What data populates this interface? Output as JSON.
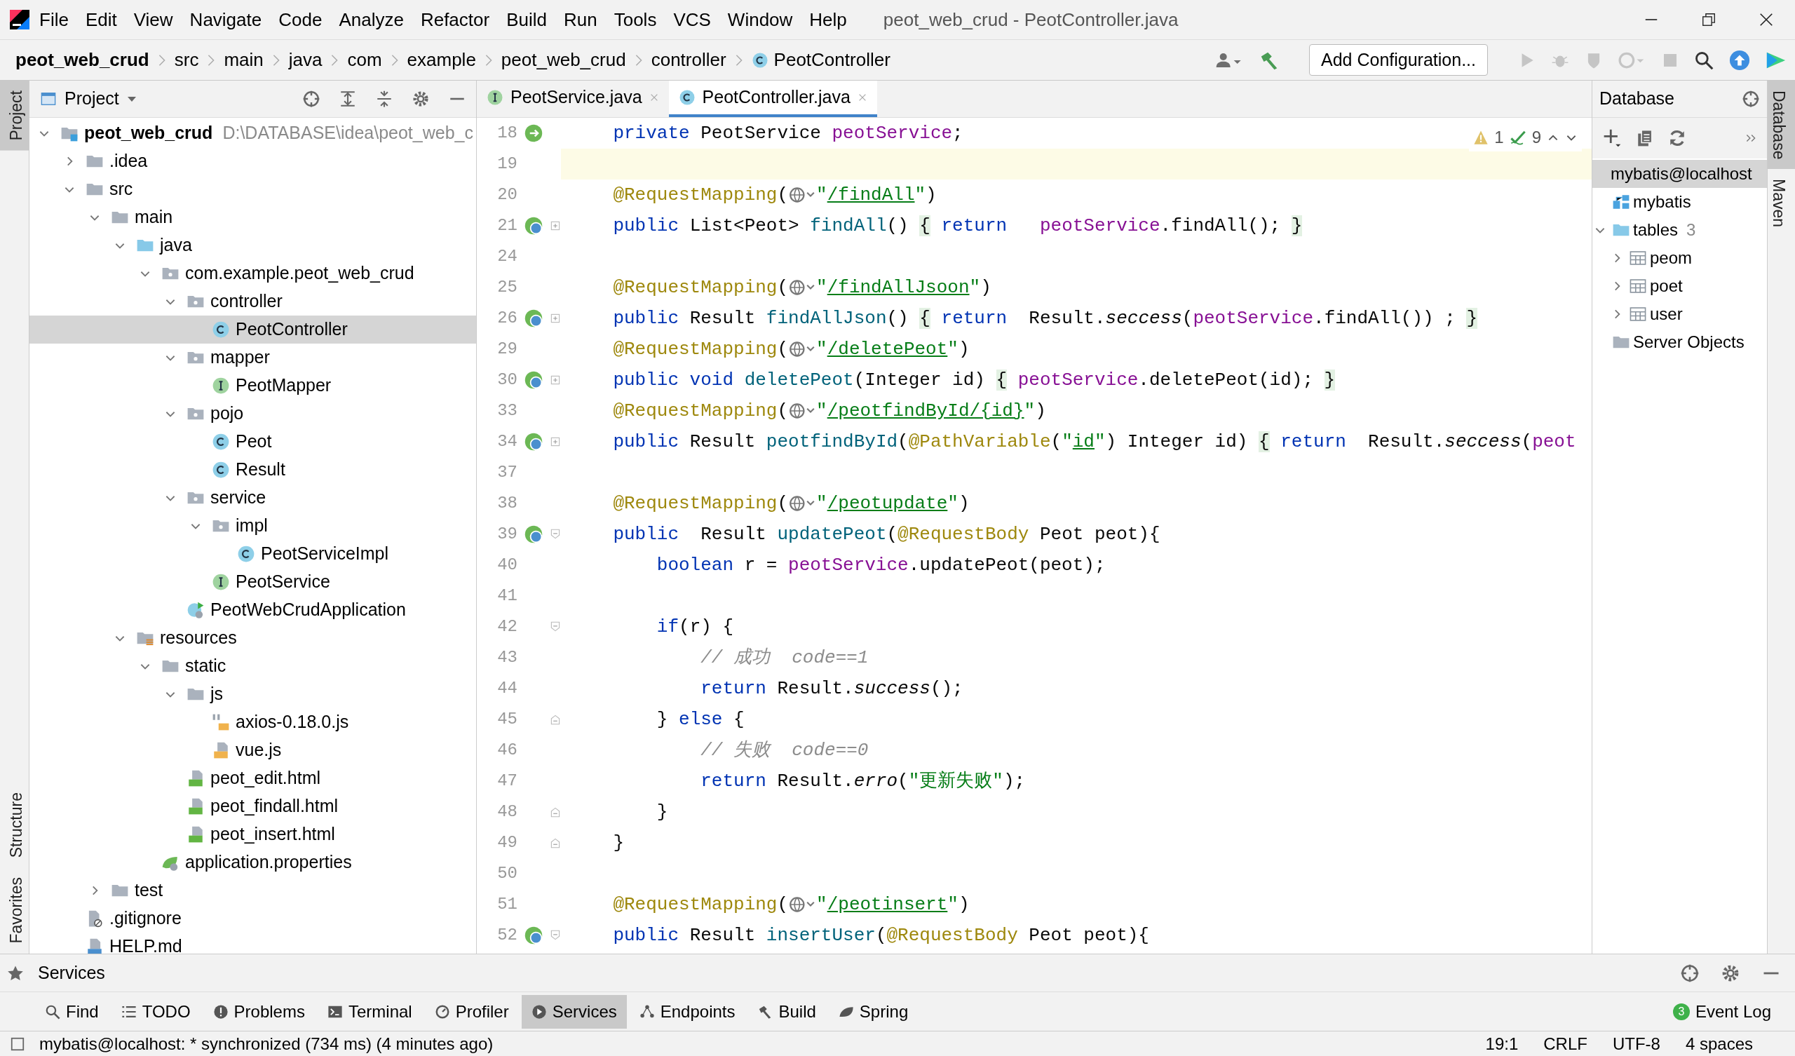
{
  "menu_bar": {
    "items": [
      "File",
      "Edit",
      "View",
      "Navigate",
      "Code",
      "Analyze",
      "Refactor",
      "Build",
      "Run",
      "Tools",
      "VCS",
      "Window",
      "Help"
    ],
    "window_title": "peot_web_crud - PeotController.java"
  },
  "breadcrumbs": [
    "peot_web_crud",
    "src",
    "main",
    "java",
    "com",
    "example",
    "peot_web_crud",
    "controller",
    "PeotController"
  ],
  "run_configuration": "Add Configuration...",
  "left_tool_stripe": [
    {
      "label": "Project",
      "selected": true
    },
    {
      "label": "Structure",
      "selected": false
    },
    {
      "label": "Favorites",
      "selected": false
    }
  ],
  "project": {
    "title": "Project",
    "tree": [
      {
        "label": "peot_web_crud",
        "kind": "module",
        "note": "D:\\DATABASE\\idea\\peot_web_c",
        "expanded": true,
        "selected": false,
        "children": [
          {
            "label": ".idea",
            "kind": "folder",
            "expanded": false,
            "selected": false
          },
          {
            "label": "src",
            "kind": "folder",
            "expanded": true,
            "selected": false,
            "children": [
              {
                "label": "main",
                "kind": "folder",
                "expanded": true,
                "selected": false,
                "children": [
                  {
                    "label": "java",
                    "kind": "java-folder",
                    "expanded": true,
                    "selected": false,
                    "children": [
                      {
                        "label": "com.example.peot_web_crud",
                        "kind": "package",
                        "expanded": true,
                        "selected": false,
                        "children": [
                          {
                            "label": "controller",
                            "kind": "package",
                            "expanded": true,
                            "selected": false,
                            "children": [
                              {
                                "label": "PeotController",
                                "kind": "class",
                                "selected": true
                              }
                            ]
                          },
                          {
                            "label": "mapper",
                            "kind": "package",
                            "expanded": true,
                            "selected": false,
                            "children": [
                              {
                                "label": "PeotMapper",
                                "kind": "interface",
                                "selected": false
                              }
                            ]
                          },
                          {
                            "label": "pojo",
                            "kind": "package",
                            "expanded": true,
                            "selected": false,
                            "children": [
                              {
                                "label": "Peot",
                                "kind": "class",
                                "selected": false
                              },
                              {
                                "label": "Result",
                                "kind": "class",
                                "selected": false
                              }
                            ]
                          },
                          {
                            "label": "service",
                            "kind": "package",
                            "expanded": true,
                            "selected": false,
                            "children": [
                              {
                                "label": "impl",
                                "kind": "package",
                                "expanded": true,
                                "selected": false,
                                "children": [
                                  {
                                    "label": "PeotServiceImpl",
                                    "kind": "class",
                                    "selected": false
                                  }
                                ]
                              },
                              {
                                "label": "PeotService",
                                "kind": "interface",
                                "selected": false
                              }
                            ]
                          },
                          {
                            "label": "PeotWebCrudApplication",
                            "kind": "spring-app",
                            "selected": false
                          }
                        ]
                      }
                    ]
                  },
                  {
                    "label": "resources",
                    "kind": "resources",
                    "expanded": true,
                    "selected": false,
                    "children": [
                      {
                        "label": "static",
                        "kind": "folder",
                        "expanded": true,
                        "selected": false,
                        "children": [
                          {
                            "label": "js",
                            "kind": "folder",
                            "expanded": true,
                            "selected": false,
                            "children": [
                              {
                                "label": "axios-0.18.0.js",
                                "kind": "js-lib",
                                "selected": false
                              },
                              {
                                "label": "vue.js",
                                "kind": "js",
                                "selected": false
                              }
                            ]
                          },
                          {
                            "label": "peot_edit.html",
                            "kind": "html",
                            "selected": false
                          },
                          {
                            "label": "peot_findall.html",
                            "kind": "html",
                            "selected": false
                          },
                          {
                            "label": "peot_insert.html",
                            "kind": "html",
                            "selected": false
                          }
                        ]
                      },
                      {
                        "label": "application.properties",
                        "kind": "properties",
                        "selected": false
                      }
                    ]
                  }
                ]
              },
              {
                "label": "test",
                "kind": "folder",
                "expanded": false,
                "selected": false
              }
            ]
          },
          {
            "label": ".gitignore",
            "kind": "gitignore",
            "selected": false
          },
          {
            "label": "HELP.md",
            "kind": "md",
            "selected": false
          }
        ]
      }
    ]
  },
  "editor": {
    "tabs": [
      {
        "label": "PeotService.java",
        "kind": "interface",
        "selected": false
      },
      {
        "label": "PeotController.java",
        "kind": "class",
        "selected": true
      }
    ],
    "inspections": {
      "warnings": "1",
      "weak_warnings": "9"
    },
    "lines": [
      {
        "number": "18",
        "gutter_icon": {
          "kind": "bean"
        },
        "current": false,
        "tokens": [
          {
            "kind": "kw",
            "t": "private"
          },
          {
            "kind": "p",
            "t": " PeotService "
          },
          {
            "kind": "f",
            "t": "peotService"
          },
          {
            "kind": "p",
            "t": ";"
          }
        ]
      },
      {
        "number": "19",
        "current": true
      },
      {
        "number": "20",
        "current": false,
        "tokens": [
          {
            "kind": "an",
            "t": "@RequestMapping"
          },
          {
            "kind": "p",
            "t": "("
          },
          {
            "kind": "route"
          },
          {
            "kind": "s",
            "t": "\""
          },
          {
            "kind": "su",
            "t": "/findAll"
          },
          {
            "kind": "s",
            "t": "\""
          },
          {
            "kind": "p",
            "t": ")"
          }
        ]
      },
      {
        "number": "21",
        "gutter_icon": {
          "kind": "web"
        },
        "fold": {
          "kind": "collapsed"
        },
        "current": false,
        "tokens": [
          {
            "kind": "kw",
            "t": "public"
          },
          {
            "kind": "p",
            "t": " List<Peot> "
          },
          {
            "kind": "m",
            "t": "findAll"
          },
          {
            "kind": "p",
            "t": "() "
          },
          {
            "kind": "b",
            "t": "{"
          },
          {
            "kind": "kw",
            "t": " return   "
          },
          {
            "kind": "f",
            "t": "peotService"
          },
          {
            "kind": "p",
            "t": ".findAll(); "
          },
          {
            "kind": "b",
            "t": "}"
          }
        ]
      },
      {
        "number": "24",
        "current": false
      },
      {
        "number": "25",
        "current": false,
        "tokens": [
          {
            "kind": "an",
            "t": "@RequestMapping"
          },
          {
            "kind": "p",
            "t": "("
          },
          {
            "kind": "route"
          },
          {
            "kind": "s",
            "t": "\""
          },
          {
            "kind": "su",
            "t": "/findAllJsoon"
          },
          {
            "kind": "s",
            "t": "\""
          },
          {
            "kind": "p",
            "t": ")"
          }
        ]
      },
      {
        "number": "26",
        "gutter_icon": {
          "kind": "web"
        },
        "fold": {
          "kind": "collapsed"
        },
        "current": false,
        "tokens": [
          {
            "kind": "kw",
            "t": "public"
          },
          {
            "kind": "p",
            "t": " Result "
          },
          {
            "kind": "m",
            "t": "findAllJson"
          },
          {
            "kind": "p",
            "t": "() "
          },
          {
            "kind": "b",
            "t": "{"
          },
          {
            "kind": "kw",
            "t": " return"
          },
          {
            "kind": "p",
            "t": "  Result."
          },
          {
            "kind": "i",
            "t": "seccess"
          },
          {
            "kind": "p",
            "t": "("
          },
          {
            "kind": "f",
            "t": "peotService"
          },
          {
            "kind": "p",
            "t": ".findAll()) ; "
          },
          {
            "kind": "b",
            "t": "}"
          }
        ]
      },
      {
        "number": "29",
        "current": false,
        "tokens": [
          {
            "kind": "an",
            "t": "@RequestMapping"
          },
          {
            "kind": "p",
            "t": "("
          },
          {
            "kind": "route"
          },
          {
            "kind": "s",
            "t": "\""
          },
          {
            "kind": "su",
            "t": "/deletePeot"
          },
          {
            "kind": "s",
            "t": "\""
          },
          {
            "kind": "p",
            "t": ")"
          }
        ]
      },
      {
        "number": "30",
        "gutter_icon": {
          "kind": "web"
        },
        "fold": {
          "kind": "collapsed"
        },
        "current": false,
        "tokens": [
          {
            "kind": "kw",
            "t": "public void "
          },
          {
            "kind": "m",
            "t": "deletePeot"
          },
          {
            "kind": "p",
            "t": "(Integer id) "
          },
          {
            "kind": "b",
            "t": "{"
          },
          {
            "kind": "f",
            "t": " peotService"
          },
          {
            "kind": "p",
            "t": ".deletePeot(id); "
          },
          {
            "kind": "b",
            "t": "}"
          }
        ]
      },
      {
        "number": "33",
        "current": false,
        "tokens": [
          {
            "kind": "an",
            "t": "@RequestMapping"
          },
          {
            "kind": "p",
            "t": "("
          },
          {
            "kind": "route"
          },
          {
            "kind": "s",
            "t": "\""
          },
          {
            "kind": "su",
            "t": "/peotfindById/{id}"
          },
          {
            "kind": "s",
            "t": "\""
          },
          {
            "kind": "p",
            "t": ")"
          }
        ]
      },
      {
        "number": "34",
        "gutter_icon": {
          "kind": "web"
        },
        "fold": {
          "kind": "collapsed"
        },
        "current": false,
        "tokens": [
          {
            "kind": "kw",
            "t": "public"
          },
          {
            "kind": "p",
            "t": " Result "
          },
          {
            "kind": "m",
            "t": "peotfindById"
          },
          {
            "kind": "p",
            "t": "("
          },
          {
            "kind": "an",
            "t": "@PathVariable"
          },
          {
            "kind": "p",
            "t": "("
          },
          {
            "kind": "s",
            "t": "\""
          },
          {
            "kind": "su",
            "t": "id"
          },
          {
            "kind": "s",
            "t": "\""
          },
          {
            "kind": "p",
            "t": ") Integer id) "
          },
          {
            "kind": "b",
            "t": "{"
          },
          {
            "kind": "kw",
            "t": " return"
          },
          {
            "kind": "p",
            "t": "  Result."
          },
          {
            "kind": "i",
            "t": "seccess"
          },
          {
            "kind": "p",
            "t": "("
          },
          {
            "kind": "f",
            "t": "peot"
          }
        ]
      },
      {
        "number": "37",
        "current": false
      },
      {
        "number": "38",
        "current": false,
        "tokens": [
          {
            "kind": "an",
            "t": "@RequestMapping"
          },
          {
            "kind": "p",
            "t": "("
          },
          {
            "kind": "route"
          },
          {
            "kind": "s",
            "t": "\""
          },
          {
            "kind": "su",
            "t": "/peotupdate"
          },
          {
            "kind": "s",
            "t": "\""
          },
          {
            "kind": "p",
            "t": ")"
          }
        ]
      },
      {
        "number": "39",
        "gutter_icon": {
          "kind": "web"
        },
        "fold": {
          "kind": "open"
        },
        "current": false,
        "tokens": [
          {
            "kind": "kw",
            "t": "public"
          },
          {
            "kind": "p",
            "t": "  Result "
          },
          {
            "kind": "m",
            "t": "updatePeot"
          },
          {
            "kind": "p",
            "t": "("
          },
          {
            "kind": "an",
            "t": "@RequestBody"
          },
          {
            "kind": "p",
            "t": " Peot peot){"
          }
        ],
        "children": [
          {
            "number": "40",
            "current": false,
            "tokens": [
              {
                "kind": "kw",
                "t": "boolean"
              },
              {
                "kind": "p",
                "t": " r = "
              },
              {
                "kind": "f",
                "t": "peotService"
              },
              {
                "kind": "p",
                "t": ".updatePeot(peot);"
              }
            ]
          },
          {
            "number": "41",
            "current": false
          },
          {
            "number": "42",
            "fold": {
              "kind": "open"
            },
            "current": false,
            "tokens": [
              {
                "kind": "kw",
                "t": "if"
              },
              {
                "kind": "p",
                "t": "(r) {"
              }
            ],
            "children": [
              {
                "number": "43",
                "current": false,
                "tokens": [
                  {
                    "kind": "c",
                    "t": "// 成功  code==1"
                  }
                ]
              },
              {
                "number": "44",
                "current": false,
                "tokens": [
                  {
                    "kind": "kw",
                    "t": "return"
                  },
                  {
                    "kind": "p",
                    "t": " Result."
                  },
                  {
                    "kind": "i",
                    "t": "success"
                  },
                  {
                    "kind": "p",
                    "t": "();"
                  }
                ]
              }
            ]
          },
          {
            "number": "45",
            "fold": {
              "kind": "close"
            },
            "current": false,
            "tokens": [
              {
                "kind": "p",
                "t": "} "
              },
              {
                "kind": "kw",
                "t": "else"
              },
              {
                "kind": "p",
                "t": " {"
              }
            ],
            "children": [
              {
                "number": "46",
                "current": false,
                "tokens": [
                  {
                    "kind": "c",
                    "t": "// 失败  code==0"
                  }
                ]
              },
              {
                "number": "47",
                "current": false,
                "tokens": [
                  {
                    "kind": "kw",
                    "t": "return"
                  },
                  {
                    "kind": "p",
                    "t": " Result."
                  },
                  {
                    "kind": "i",
                    "t": "erro"
                  },
                  {
                    "kind": "p",
                    "t": "("
                  },
                  {
                    "kind": "s",
                    "t": "\"更新失败\""
                  },
                  {
                    "kind": "p",
                    "t": ");"
                  }
                ]
              }
            ]
          },
          {
            "number": "48",
            "fold": {
              "kind": "close"
            },
            "current": false,
            "tokens": [
              {
                "kind": "p",
                "t": "}"
              }
            ]
          }
        ]
      },
      {
        "number": "49",
        "fold": {
          "kind": "close"
        },
        "current": false,
        "tokens": [
          {
            "kind": "p",
            "t": "}"
          }
        ]
      },
      {
        "number": "50",
        "current": false
      },
      {
        "number": "51",
        "current": false,
        "tokens": [
          {
            "kind": "an",
            "t": "@RequestMapping"
          },
          {
            "kind": "p",
            "t": "("
          },
          {
            "kind": "route"
          },
          {
            "kind": "s",
            "t": "\""
          },
          {
            "kind": "su",
            "t": "/peotinsert"
          },
          {
            "kind": "s",
            "t": "\""
          },
          {
            "kind": "p",
            "t": ")"
          }
        ]
      },
      {
        "number": "52",
        "gutter_icon": {
          "kind": "web"
        },
        "fold": {
          "kind": "open"
        },
        "current": false,
        "tokens": [
          {
            "kind": "kw",
            "t": "public"
          },
          {
            "kind": "p",
            "t": " Result "
          },
          {
            "kind": "m",
            "t": "insertUser"
          },
          {
            "kind": "p",
            "t": "("
          },
          {
            "kind": "an",
            "t": "@RequestBody"
          },
          {
            "kind": "p",
            "t": " Peot peot){"
          }
        ]
      }
    ]
  },
  "database": {
    "title": "Database",
    "tree": [
      {
        "label": "mybatis@localhost",
        "selected": true
      },
      {
        "label": "mybatis",
        "kind": "schema",
        "selected": false
      },
      {
        "label": "tables",
        "kind": "java-folder",
        "count": "3",
        "expanded": true,
        "selected": false,
        "children": [
          {
            "label": "peom",
            "kind": "table",
            "expanded": false,
            "selected": false
          },
          {
            "label": "poet",
            "kind": "table",
            "expanded": false,
            "selected": false
          },
          {
            "label": "user",
            "kind": "table",
            "expanded": false,
            "selected": false
          }
        ]
      },
      {
        "label": "Server Objects",
        "kind": "folder",
        "selected": false
      }
    ]
  },
  "right_tool_stripe": [
    {
      "label": "Database",
      "selected": true
    },
    {
      "label": "Maven",
      "selected": false
    }
  ],
  "services_panel": {
    "title": "Services"
  },
  "tool_windows": [
    {
      "label": "Find",
      "selected": false
    },
    {
      "label": "TODO",
      "selected": false
    },
    {
      "label": "Problems",
      "selected": false
    },
    {
      "label": "Terminal",
      "selected": false
    },
    {
      "label": "Profiler",
      "selected": false
    },
    {
      "label": "Services",
      "selected": true
    },
    {
      "label": "Endpoints",
      "selected": false
    },
    {
      "label": "Build",
      "selected": false
    },
    {
      "label": "Spring",
      "selected": false
    }
  ],
  "event_log": {
    "label": "Event Log",
    "count": "3"
  },
  "status_bar": {
    "message": "mybatis@localhost: * synchronized (734 ms) (4 minutes ago)",
    "position": "19:1",
    "line_separator": "CRLF",
    "encoding": "UTF-8",
    "indent": "4 spaces"
  }
}
